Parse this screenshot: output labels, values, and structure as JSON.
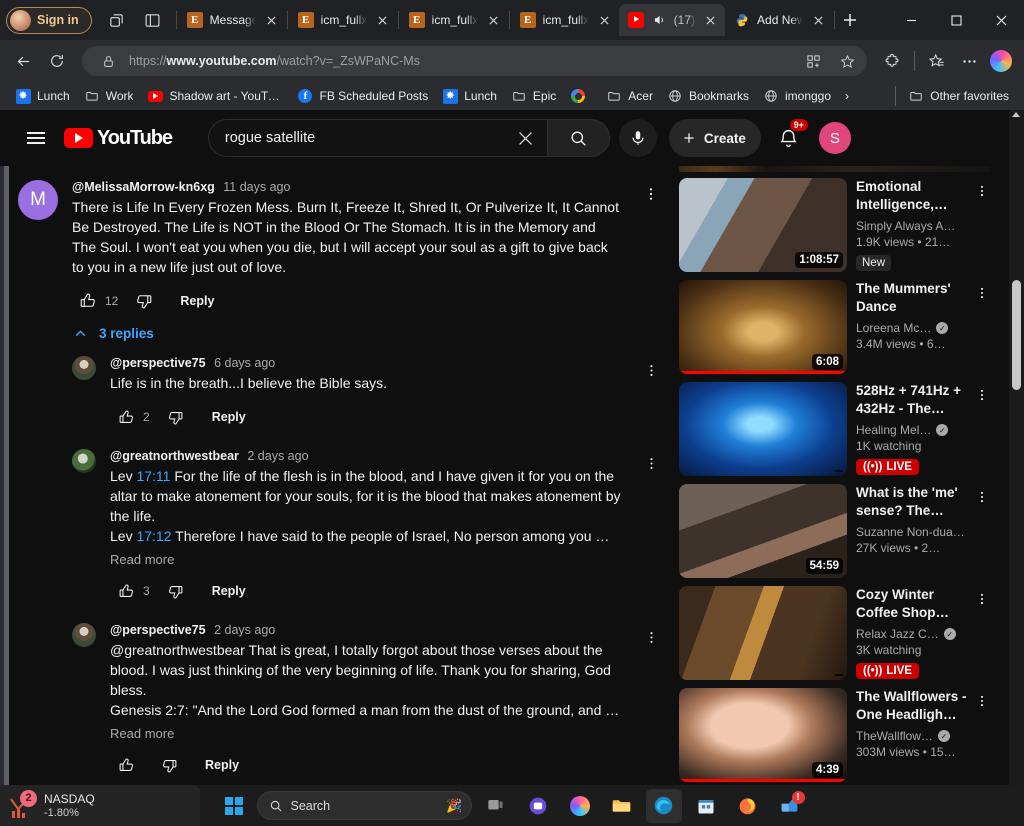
{
  "browser": {
    "signin_label": "Sign in",
    "tabs": [
      {
        "title": "Message",
        "icon": "epic-e-icon",
        "active": false
      },
      {
        "title": "icm_fullx",
        "icon": "epic-e-icon",
        "active": false
      },
      {
        "title": "icm_fullx",
        "icon": "epic-e-icon",
        "active": false
      },
      {
        "title": "icm_fullx",
        "icon": "epic-e-icon",
        "active": false
      },
      {
        "title": "(17)",
        "icon": "youtube-icon",
        "active": true
      },
      {
        "title": "Add New",
        "icon": "python-icon",
        "active": false
      }
    ],
    "url_prefix": "https://",
    "url_domain": "www.youtube.com",
    "url_path": "/watch?v=_ZsWPaNC-Ms",
    "bookmarks": [
      {
        "label": "Lunch",
        "icon": "bluestar-icon"
      },
      {
        "label": "Work",
        "icon": "folder-icon"
      },
      {
        "label": "Shadow art - YouTu...",
        "icon": "youtube-icon"
      },
      {
        "label": "FB Scheduled Posts",
        "icon": "facebook-icon"
      },
      {
        "label": "Lunch",
        "icon": "bluestar-icon"
      },
      {
        "label": "Epic",
        "icon": "folder-icon"
      },
      {
        "label": "",
        "icon": "google-icon"
      },
      {
        "label": "Acer",
        "icon": "folder-icon"
      },
      {
        "label": "Bookmarks",
        "icon": "globe-icon"
      },
      {
        "label": "imonggo",
        "icon": "globe-icon"
      }
    ],
    "bookmarks_overflow": "›",
    "other_favorites": "Other favorites"
  },
  "youtube": {
    "brand": "YouTube",
    "search_value": "rogue satellite",
    "search_placeholder": "Search",
    "create_label": "Create",
    "notification_count": "9+",
    "avatar_initial": "S",
    "comments": [
      {
        "author": "@MelissaMorrow-kn6xg",
        "when": "11 days ago",
        "avatar_initial": "M",
        "avatar_color": "#9b6fe0",
        "text": "There is Life In Every Frozen Mess. Burn It, Freeze It, Shred It, Or Pulverize It, It Cannot Be Destroyed. The Life is NOT in the Blood Or The Stomach. It is in the Memory and The Soul. I won't eat you when you die, but I will accept your soul as a gift to give back to you in a new life just out of love.",
        "likes": "12",
        "reply_label": "Reply",
        "read_more": ""
      }
    ],
    "replies_toggle": "3 replies",
    "replies": [
      {
        "author": "@perspective75",
        "when": "6 days ago",
        "text": "Life is in the breath...I believe the Bible says.",
        "likes": "2",
        "reply_label": "Reply",
        "read_more": ""
      },
      {
        "author": "@greatnorthwestbear",
        "when": "2 days ago",
        "text_line1_prefix": "Lev ",
        "text_line1_ref": "17:11",
        "text_line1_rest": "  For the life of the flesh is in the blood, and I have given it for you on the altar to make atonement for your souls, for it is the blood that makes atonement by the life.",
        "text_line2_prefix": "Lev ",
        "text_line2_ref": "17:12",
        "text_line2_rest": "  Therefore I have said to the people of Israel, No person among you …",
        "likes": "3",
        "reply_label": "Reply",
        "read_more": "Read more"
      },
      {
        "author": "@perspective75",
        "when": "2 days ago",
        "text": "@greatnorthwestbear  That is great, I totally forgot about those verses about the blood. I was just thinking of the very beginning of life. Thank you for sharing, God bless.\nGenesis 2:7: \"And the Lord God formed a man from the dust of the ground, and …",
        "likes": "",
        "reply_label": "Reply",
        "read_more": "Read more"
      }
    ],
    "sidebar_videos": [
      {
        "title": "Emotional Intelligence,…",
        "channel": "Simply Always A…",
        "verified": false,
        "stats": "1.9K views  •  21…",
        "duration": "1:08:57",
        "badge": "New",
        "live": false,
        "progress_pct": 0
      },
      {
        "title": "The Mummers' Dance",
        "channel": "Loreena Mc…",
        "verified": true,
        "stats": "3.4M views  •  6…",
        "duration": "6:08",
        "badge": "",
        "live": false,
        "progress_pct": 100
      },
      {
        "title": "528Hz + 741Hz + 432Hz - The…",
        "channel": "Healing Mel…",
        "verified": true,
        "stats": "1K watching",
        "duration": "",
        "badge": "",
        "live": true,
        "live_label": "LIVE",
        "progress_pct": 0
      },
      {
        "title": "What is the 'me' sense? The…",
        "channel": "Suzanne Non-dua…",
        "verified": false,
        "stats": "27K views  •  2…",
        "duration": "54:59",
        "badge": "",
        "live": false,
        "progress_pct": 0
      },
      {
        "title": "Cozy Winter Coffee Shop…",
        "channel": "Relax Jazz C…",
        "verified": true,
        "stats": "3K watching",
        "duration": "",
        "badge": "",
        "live": true,
        "live_label": "LIVE",
        "progress_pct": 0
      },
      {
        "title": "The Wallflowers - One Headligh…",
        "channel": "TheWallflow…",
        "verified": true,
        "stats": "303M views  •  15…",
        "duration": "4:39",
        "badge": "",
        "live": false,
        "progress_pct": 100
      }
    ]
  },
  "taskbar": {
    "widget_title": "NASDAQ",
    "widget_value": "-1.80%",
    "widget_badge": "2",
    "search_label": "Search",
    "apps": [
      {
        "name": "task-view-icon"
      },
      {
        "name": "teams-icon"
      },
      {
        "name": "copilot-icon"
      },
      {
        "name": "file-explorer-icon"
      },
      {
        "name": "edge-icon"
      },
      {
        "name": "microsoft-store-icon"
      },
      {
        "name": "firefox-icon"
      },
      {
        "name": "onedrive-alert-icon"
      }
    ]
  },
  "colors": {
    "yt_red": "#ff0000",
    "yt_link": "#3ea6ff",
    "accent_blue": "#2aa6f0"
  }
}
